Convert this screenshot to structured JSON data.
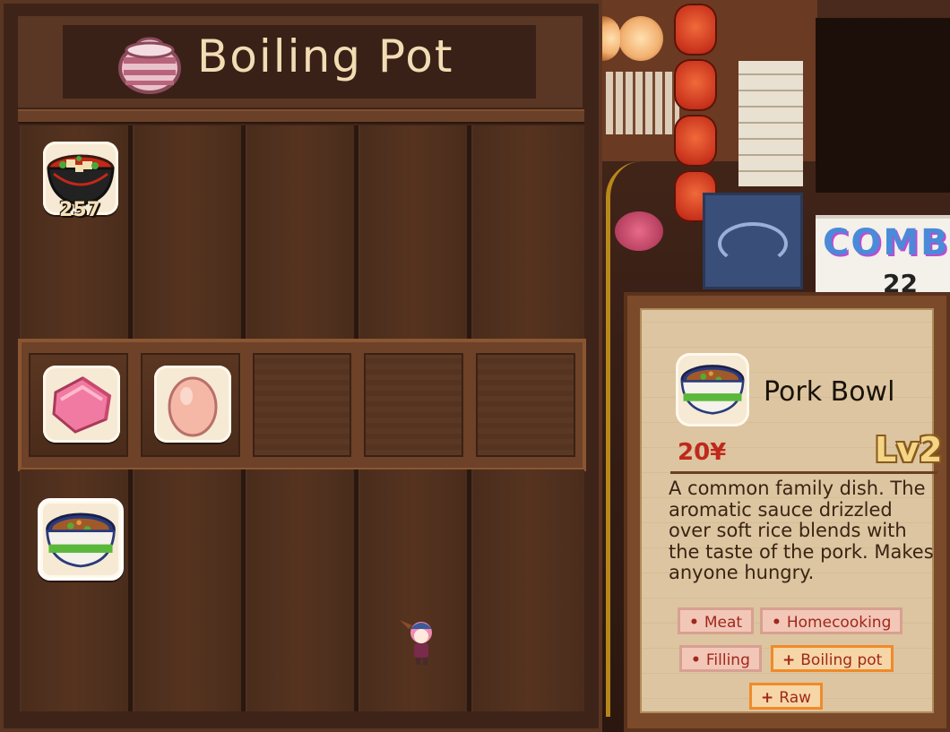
{
  "window": {
    "title": "Boiling Pot"
  },
  "shelf": {
    "items": [
      {
        "id": "soup",
        "name": "Miso Soup",
        "count": "257",
        "icon": "miso-soup-icon"
      },
      {
        "id": "meat",
        "name": "Meat",
        "icon": "meat-icon"
      },
      {
        "id": "egg",
        "name": "Egg",
        "icon": "egg-icon"
      },
      {
        "id": "bowl",
        "name": "Pork Bowl",
        "icon": "pork-bowl-icon"
      }
    ]
  },
  "detail": {
    "name": "Pork Bowl",
    "price": "20¥",
    "level": "Lv2",
    "description": "A common family dish. The aromatic sauce drizzled over soft rice blends with the taste of the pork. Makes anyone hungry.",
    "tags": [
      {
        "label": "Meat",
        "mark": "•",
        "style": "pink"
      },
      {
        "label": "Homecooking",
        "mark": "•",
        "style": "pink"
      },
      {
        "label": "Filling",
        "mark": "•",
        "style": "pink"
      },
      {
        "label": "Boiling pot",
        "mark": "+",
        "style": "orange"
      },
      {
        "label": "Raw",
        "mark": "+",
        "style": "orange"
      }
    ]
  },
  "background": {
    "sign_text": "COMBO",
    "sign_number": "22"
  },
  "colors": {
    "price": "#c0281c",
    "level": "#f4d686",
    "tag_pink": "#f2c7b8",
    "tag_orange": "#f6d6a6"
  }
}
